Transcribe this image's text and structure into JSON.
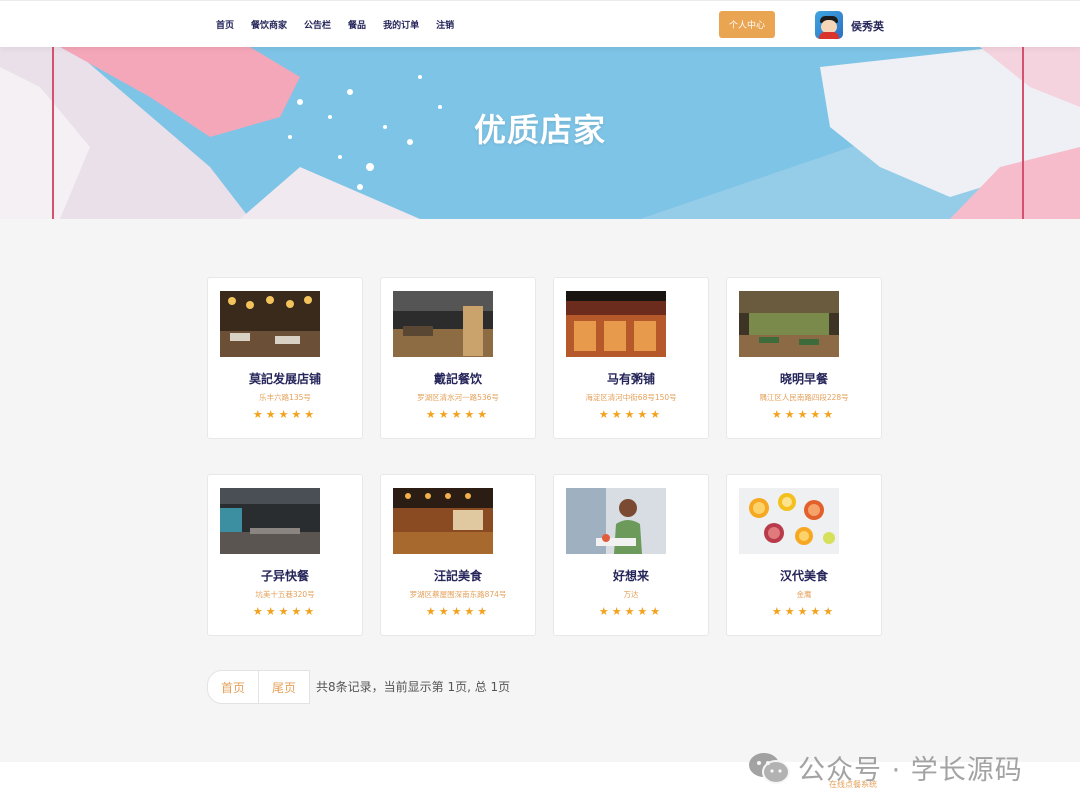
{
  "header": {
    "nav": [
      "首页",
      "餐饮商家",
      "公告栏",
      "餐品",
      "我的订单",
      "注销"
    ],
    "personal_button": "个人中心",
    "username": "侯秀英"
  },
  "banner": {
    "title": "优质店家"
  },
  "stores": [
    {
      "name": "莫記发展店铺",
      "address": "乐丰六路135号",
      "rating": 5
    },
    {
      "name": "戴記餐饮",
      "address": "罗湖区清水河一路536号",
      "rating": 5
    },
    {
      "name": "马有粥铺",
      "address": "海淀区清河中街68号150号",
      "rating": 5
    },
    {
      "name": "晓明早餐",
      "address": "隅江区人民南路四段228号",
      "rating": 5
    },
    {
      "name": "子异快餐",
      "address": "坑美十五巷320号",
      "rating": 5
    },
    {
      "name": "汪記美食",
      "address": "罗湖区蔡屋围深南东路874号",
      "rating": 5
    },
    {
      "name": "好想来",
      "address": "万达",
      "rating": 5
    },
    {
      "name": "汉代美食",
      "address": "金鹰",
      "rating": 5
    }
  ],
  "pagination": {
    "first": "首页",
    "last": "尾页",
    "info": "共8条记录，当前显示第 1页, 总 1页"
  },
  "footer": {
    "text": "在线点餐系统"
  },
  "watermark": {
    "text": "公众号 · 学长源码"
  },
  "colors": {
    "accent": "#eaa552",
    "nav_text": "#25255a",
    "star": "#f3a21d",
    "address": "#e4a05a"
  }
}
